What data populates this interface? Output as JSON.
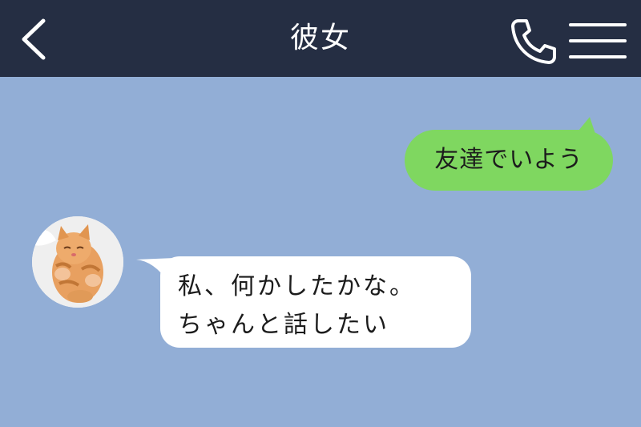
{
  "header": {
    "title": "彼女",
    "back_icon": "chevron-left-icon",
    "call_icon": "phone-icon",
    "menu_icon": "hamburger-menu-icon",
    "background": "#252e43"
  },
  "chat": {
    "background": "#92aed6",
    "messages": [
      {
        "sender": "me",
        "text": "友達でいよう",
        "bubble_color": "#7fd760"
      },
      {
        "sender": "other",
        "lines": [
          "私、何かしたかな。",
          "ちゃんと話したい"
        ],
        "bubble_color": "#ffffff",
        "avatar": "cat-avatar"
      }
    ]
  }
}
